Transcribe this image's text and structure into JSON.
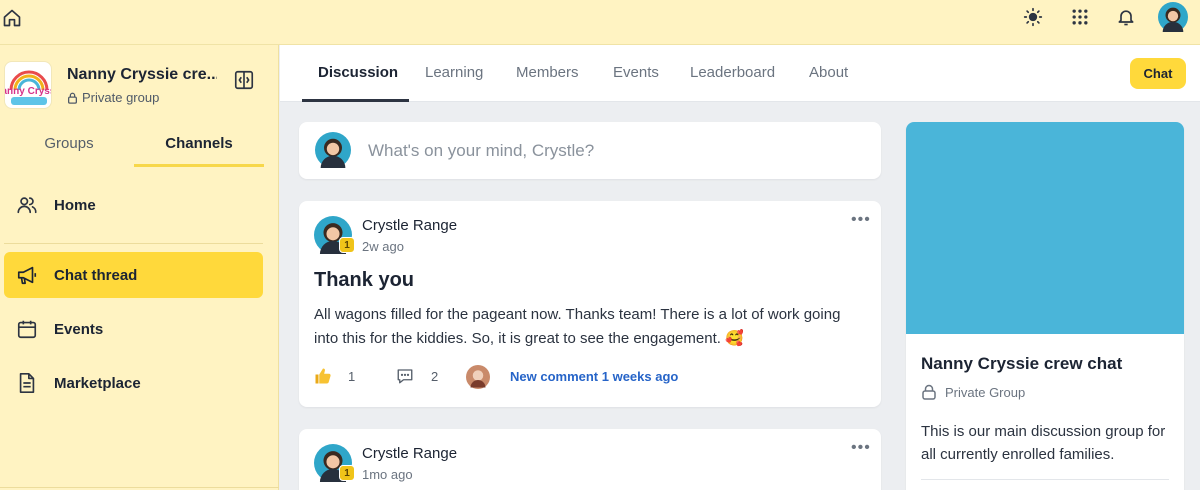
{
  "group": {
    "title": "Nanny Cryssie cre...",
    "privacy": "Private group",
    "logo_text": "Nanny Cryssie"
  },
  "sidebar": {
    "tabs": [
      {
        "label": "Groups",
        "active": false
      },
      {
        "label": "Channels",
        "active": true
      }
    ],
    "items": [
      {
        "label": "Home",
        "icon": "users-icon",
        "active": false
      },
      {
        "label": "Chat thread",
        "icon": "megaphone-icon",
        "active": true
      },
      {
        "label": "Events",
        "icon": "calendar-icon",
        "active": false
      },
      {
        "label": "Marketplace",
        "icon": "document-icon",
        "active": false
      }
    ]
  },
  "main_tabs": [
    {
      "label": "Discussion",
      "active": true
    },
    {
      "label": "Learning",
      "active": false
    },
    {
      "label": "Members",
      "active": false
    },
    {
      "label": "Events",
      "active": false
    },
    {
      "label": "Leaderboard",
      "active": false
    },
    {
      "label": "About",
      "active": false
    }
  ],
  "chat_button": "Chat",
  "composer": {
    "placeholder": "What's on your mind, Crystle?"
  },
  "posts": [
    {
      "author": "Crystle Range",
      "time": "2w ago",
      "badge": "1",
      "title": "Thank you",
      "body": "All wagons filled for the pageant now. Thanks team! There is a lot of work going into this for the kiddies. So, it is great to see the engagement. 🥰",
      "likes": "1",
      "comments": "2",
      "new_comment": "New comment 1 weeks ago"
    },
    {
      "author": "Crystle Range",
      "time": "1mo ago",
      "badge": "1"
    }
  ],
  "group_card": {
    "title": "Nanny Cryssie crew chat",
    "privacy": "Private Group",
    "description": "This is our main discussion group for all currently enrolled families.",
    "cover_color": "#4ab5d9"
  },
  "colors": {
    "sidebar_bg": "#fff3c2",
    "accent": "#ffd93b",
    "link": "#2664c8"
  }
}
